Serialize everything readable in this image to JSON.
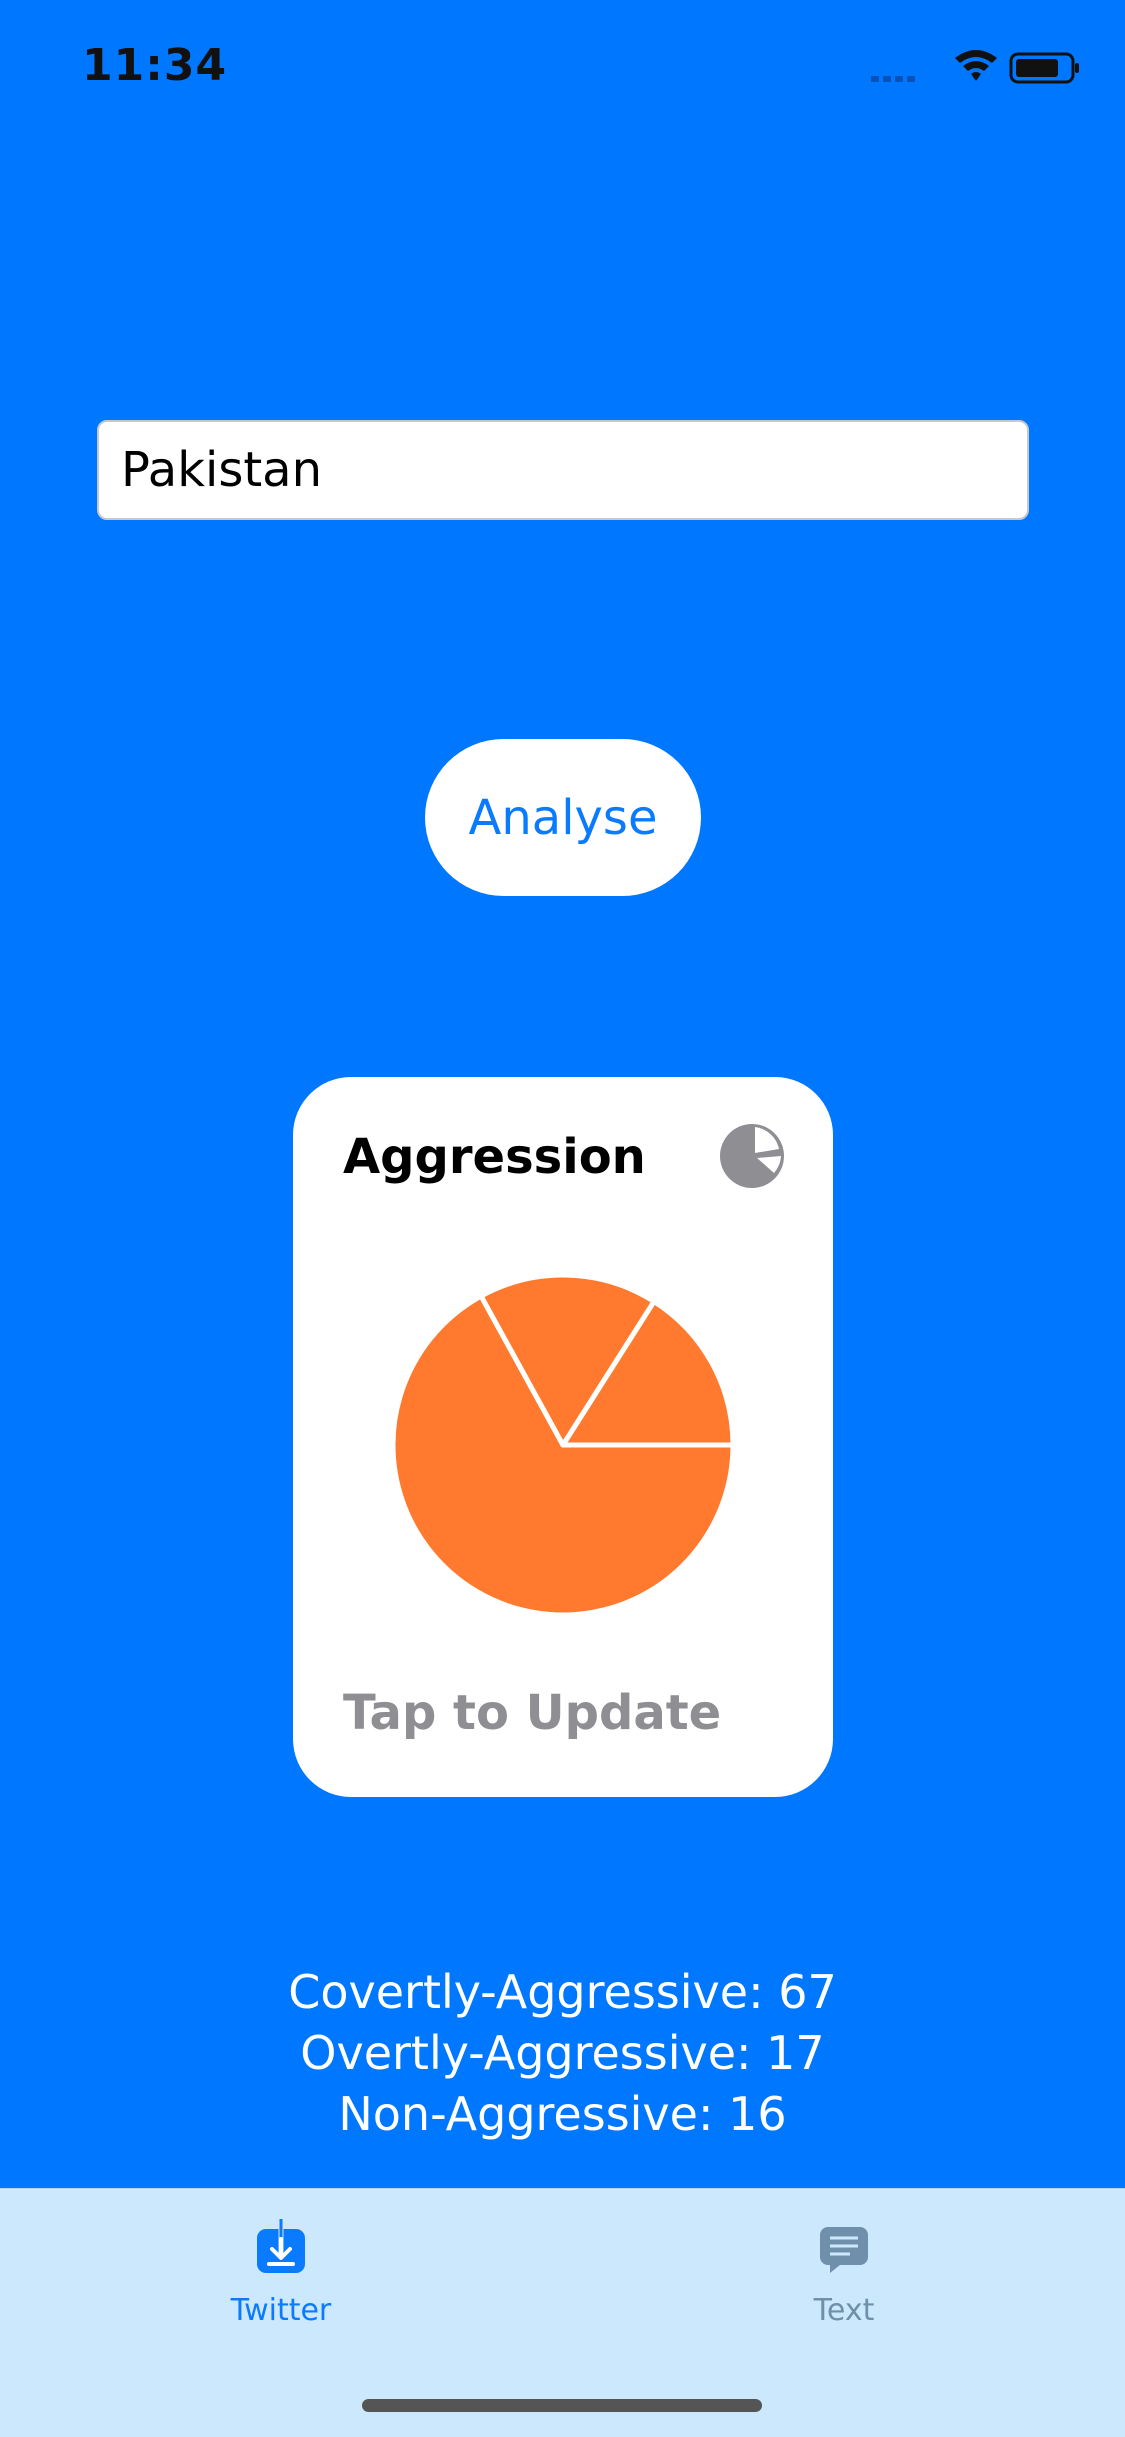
{
  "status_bar": {
    "time": "11:34"
  },
  "search": {
    "value": "Pakistan"
  },
  "analyse_button": {
    "label": "Analyse"
  },
  "card": {
    "title": "Aggression",
    "footer": "Tap to Update",
    "icon": "pie-chart-icon"
  },
  "chart_data": {
    "type": "pie",
    "categories": [
      "Covertly-Aggressive",
      "Overtly-Aggressive",
      "Non-Aggressive"
    ],
    "values": [
      67,
      17,
      16
    ],
    "color": "#FF7A2F",
    "background": "#FFFFFF"
  },
  "results": {
    "covert": "Covertly-Aggressive: 67",
    "overt": "Overtly-Aggressive: 17",
    "non": "Non-Aggressive: 16"
  },
  "tabs": [
    {
      "label": "Twitter",
      "icon": "download-tray-icon",
      "selected": true
    },
    {
      "label": "Text",
      "icon": "chat-bubble-icon",
      "selected": false
    }
  ],
  "colors": {
    "background": "#0077FF",
    "accent": "#0A7BFF",
    "tab_bar": "#CCE8FD",
    "pie": "#FF7A2F"
  }
}
